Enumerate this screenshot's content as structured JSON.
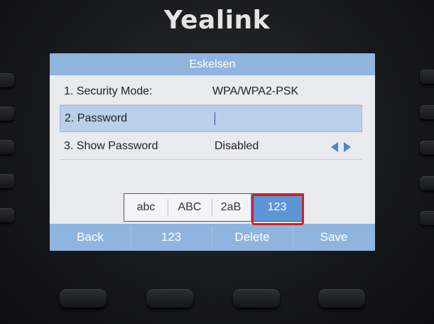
{
  "device": {
    "brand": "Yealink"
  },
  "screen": {
    "title": "Eskelsen",
    "rows": [
      {
        "label": "1. Security Mode:",
        "value": "WPA/WPA2-PSK"
      },
      {
        "label": "2. Password",
        "value": ""
      },
      {
        "label": "3. Show Password",
        "value": "Disabled"
      }
    ],
    "input_methods": [
      {
        "label": "abc",
        "selected": false
      },
      {
        "label": "ABC",
        "selected": false
      },
      {
        "label": "2aB",
        "selected": false
      },
      {
        "label": "123",
        "selected": true
      }
    ],
    "softkeys": [
      "Back",
      "123",
      "Delete",
      "Save"
    ]
  },
  "colors": {
    "title_bar": "#8fb4dd",
    "selected_row": "#b9cfea",
    "selected_input_method": "#5d95d5",
    "highlight_frame": "#cf2128"
  },
  "icons": [
    "left-arrow-icon",
    "right-arrow-icon"
  ]
}
